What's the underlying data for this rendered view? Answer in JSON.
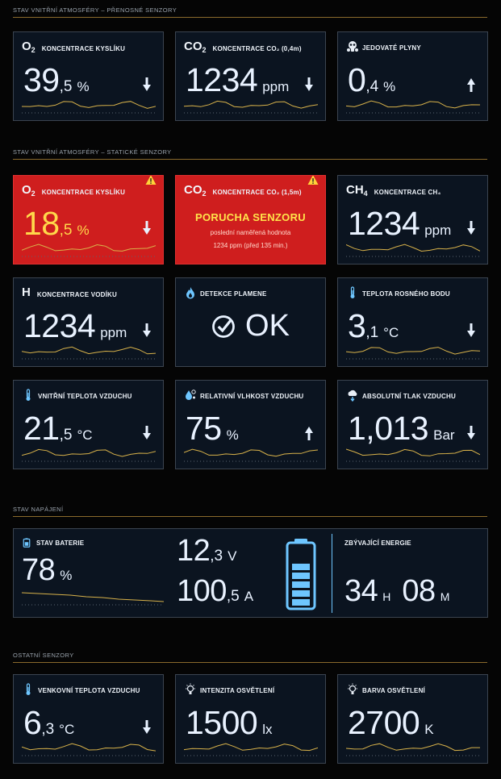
{
  "colors": {
    "accent": "#6ec6ff",
    "alarm": "#cf1e1e",
    "warning": "#ffd23a",
    "spark": "#d8b24a"
  },
  "sections": {
    "portable": "STAV VNITŘNÍ ATMOSFÉRY – PŘENOSNÉ SENZORY",
    "static": "STAV VNITŘNÍ ATMOSFÉRY – STATICKÉ SENZORY",
    "power": "STAV NAPÁJENÍ",
    "other": "OSTATNÍ SENZORY"
  },
  "portable": [
    {
      "chem": "O",
      "sub": "2",
      "label": "KONCENTRACE KYSLÍKU",
      "int": "39",
      "dec": ",5",
      "unit": "%",
      "trend": "down"
    },
    {
      "chem": "CO",
      "sub": "2",
      "label": "KONCENTRACE CO₂ (0,4m)",
      "int": "1234",
      "dec": "",
      "unit": "ppm",
      "trend": "down"
    },
    {
      "icon": "gas-mask-icon",
      "label": "JEDOVATÉ PLYNY",
      "int": "0",
      "dec": ",4",
      "unit": "%",
      "trend": "up"
    }
  ],
  "static": [
    {
      "chem": "O",
      "sub": "2",
      "label": "KONCENTRACE KYSLÍKU",
      "int": "18",
      "dec": ",5",
      "unit": "%",
      "trend": "down",
      "alarm": true
    },
    {
      "chem": "CO",
      "sub": "2",
      "label": "KONCENTRACE CO₂ (1,5m)",
      "fault_title": "PORUCHA SENZORU",
      "fault_line1": "poslední naměřená hodnota",
      "fault_line2": "1234 ppm (před 135 min.)"
    },
    {
      "chem": "CH",
      "sub": "4",
      "label": "KONCENTRACE CH₄",
      "int": "1234",
      "dec": "",
      "unit": "ppm",
      "trend": "down"
    },
    {
      "chem": "H",
      "sub": "",
      "label": "KONCENTRACE VODÍKU",
      "int": "1234",
      "dec": "",
      "unit": "ppm",
      "trend": "down"
    },
    {
      "icon": "flame-icon",
      "label": "DETEKCE PLAMENE",
      "ok": "OK"
    },
    {
      "icon": "thermometer-icon",
      "label": "TEPLOTA ROSNÉHO BODU",
      "int": "3",
      "dec": ",1",
      "unit": "°C",
      "trend": "down"
    },
    {
      "icon": "thermometer-icon",
      "label": "VNITŘNÍ TEPLOTA VZDUCHU",
      "int": "21",
      "dec": ",5",
      "unit": "°C",
      "trend": "down"
    },
    {
      "icon": "humidity-icon",
      "label": "RELATIVNÍ VLHKOST VZDUCHU",
      "int": "75",
      "dec": "",
      "unit": "%",
      "trend": "up"
    },
    {
      "icon": "pressure-icon",
      "label": "ABSOLUTNÍ TLAK VZDUCHU",
      "int": "1,013",
      "dec": "",
      "unit": "Bar",
      "trend": "down"
    }
  ],
  "power": {
    "battery_label": "STAV BATERIE",
    "battery_value": "78",
    "battery_unit": "%",
    "battery_level": 0.78,
    "voltage_int": "12",
    "voltage_dec": ",3",
    "voltage_unit": "V",
    "current_int": "100",
    "current_dec": ",5",
    "current_unit": "A",
    "energy_label": "ZBÝVAJÍCÍ ENERGIE",
    "hours": "34",
    "hours_unit": "H",
    "minutes": "08",
    "minutes_unit": "M"
  },
  "other": [
    {
      "icon": "thermometer-icon",
      "label": "VENKOVNÍ TEPLOTA VZDUCHU",
      "int": "6",
      "dec": ",3",
      "unit": "°C",
      "trend": "down"
    },
    {
      "icon": "bulb-icon",
      "label": "INTENZITA OSVĚTLENÍ",
      "int": "1500",
      "dec": "",
      "unit": "lx"
    },
    {
      "icon": "bulb-icon",
      "label": "BARVA OSVĚTLENÍ",
      "int": "2700",
      "dec": "",
      "unit": "K"
    }
  ]
}
